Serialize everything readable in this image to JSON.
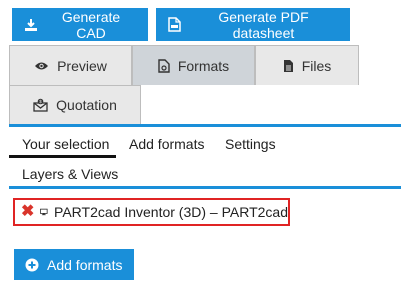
{
  "toolbar": {
    "generate_cad_label": "Generate CAD",
    "generate_pdf_label": "Generate PDF datasheet"
  },
  "tabs": [
    {
      "label": "Preview",
      "icon": "eye-icon",
      "active": false
    },
    {
      "label": "Formats",
      "icon": "file-settings-icon",
      "active": true
    },
    {
      "label": "Files",
      "icon": "file-icon",
      "active": false
    },
    {
      "label": "Quotation",
      "icon": "envelope-icon",
      "active": false
    }
  ],
  "subtabs": {
    "your_selection": "Your selection",
    "add_formats": "Add formats",
    "settings": "Settings",
    "layers_views": "Layers & Views"
  },
  "selection": {
    "item": "PART2cad Inventor (3D) – PART2cad",
    "icon": "monitor-icon"
  },
  "add_formats_button": "Add formats",
  "colors": {
    "accent": "#1a8fd9",
    "highlight_border": "#e02424",
    "remove": "#d9342b",
    "tab_active": "#cfd4d9",
    "tab_inactive": "#e8e8e8"
  }
}
